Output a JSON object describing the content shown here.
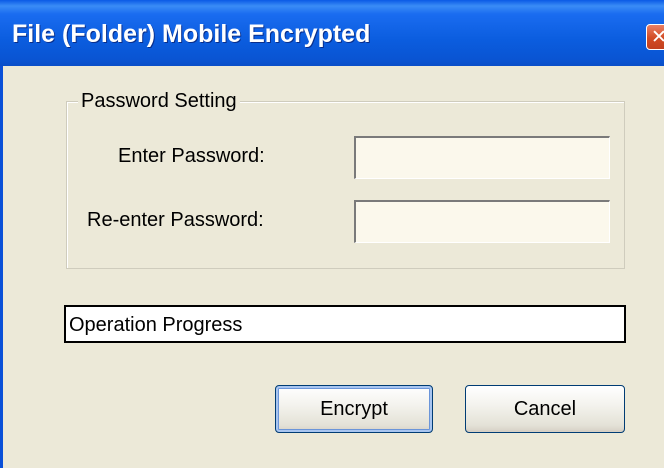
{
  "window": {
    "title": "File (Folder) Mobile Encrypted",
    "close_glyph": "✕"
  },
  "password_setting": {
    "legend": "Password Setting",
    "enter_password_label": "Enter Password:",
    "enter_password_value": "",
    "reenter_password_label": "Re-enter Password:",
    "reenter_password_value": ""
  },
  "progress": {
    "text": "Operation Progress",
    "percent": 0
  },
  "buttons": {
    "encrypt_label": "Encrypt",
    "cancel_label": "Cancel"
  },
  "colors": {
    "titlebar": "#0a5ae6",
    "window_bg": "#ece9d8",
    "close_button": "#d24b24",
    "input_bg": "#fbf8ec"
  },
  "icons": {
    "close": "close-icon"
  }
}
